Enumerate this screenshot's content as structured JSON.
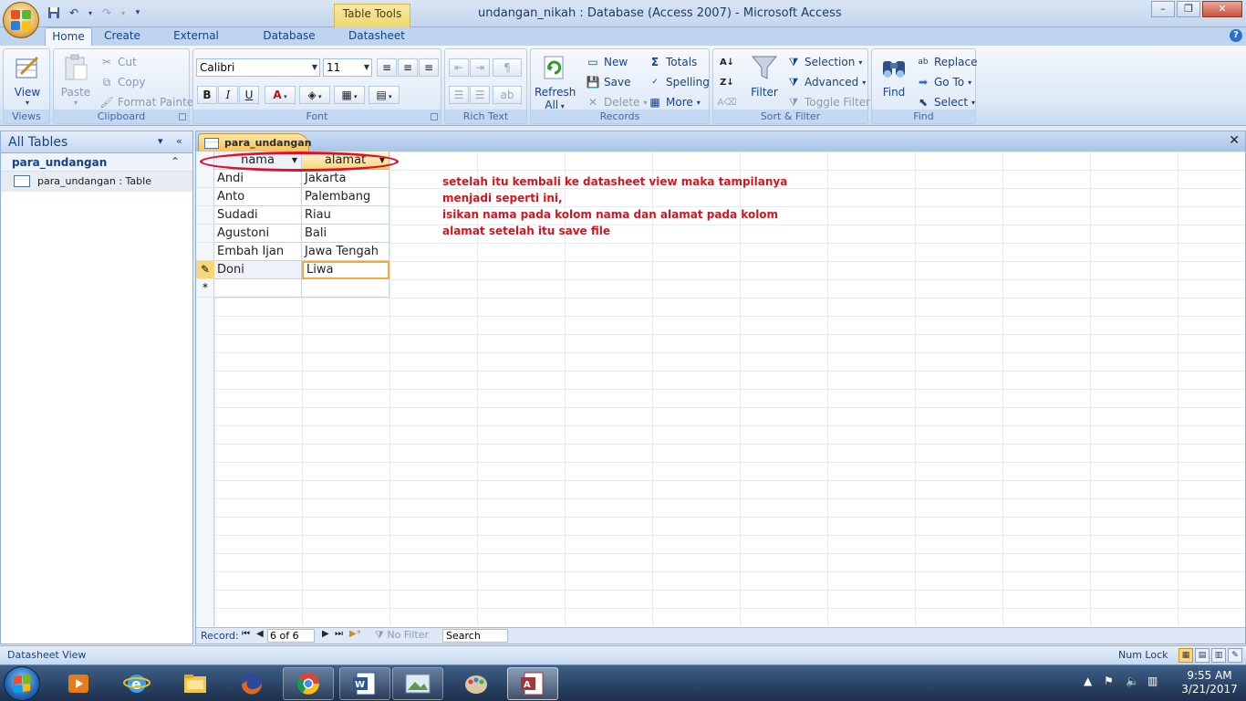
{
  "window": {
    "title": "undangan_nikah : Database (Access 2007) - Microsoft Access",
    "contextual_tab": "Table Tools"
  },
  "tabs": [
    "Home",
    "Create",
    "External Data",
    "Database Tools",
    "Datasheet"
  ],
  "ribbon": {
    "views": {
      "view": "View",
      "group": "Views"
    },
    "clipboard": {
      "paste": "Paste",
      "cut": "Cut",
      "copy": "Copy",
      "format_painter": "Format Painter",
      "group": "Clipboard"
    },
    "font": {
      "name": "Calibri",
      "size": "11",
      "bold": "B",
      "italic": "I",
      "underline": "U",
      "font_color": "A",
      "group": "Font"
    },
    "rich_text": {
      "group": "Rich Text"
    },
    "records": {
      "refresh": "Refresh",
      "refresh2": "All",
      "new": "New",
      "save": "Save",
      "delete": "Delete",
      "totals": "Totals",
      "spelling": "Spelling",
      "more": "More",
      "group": "Records"
    },
    "sort_filter": {
      "filter": "Filter",
      "selection": "Selection",
      "advanced": "Advanced",
      "toggle_filter": "Toggle Filter",
      "group": "Sort & Filter"
    },
    "find": {
      "find": "Find",
      "replace": "Replace",
      "goto": "Go To",
      "select": "Select",
      "group": "Find"
    }
  },
  "nav": {
    "header": "All Tables",
    "group": "para_undangan",
    "item": "para_undangan : Table"
  },
  "document": {
    "tab": "para_undangan",
    "columns": [
      "nama",
      "alamat"
    ],
    "rows": [
      {
        "nama": "Andi",
        "alamat": "Jakarta"
      },
      {
        "nama": "Anto",
        "alamat": "Palembang"
      },
      {
        "nama": "Sudadi",
        "alamat": "Riau"
      },
      {
        "nama": "Agustoni",
        "alamat": "Bali"
      },
      {
        "nama": "Embah Ijan",
        "alamat": "Jawa Tengah"
      },
      {
        "nama": "Doni",
        "alamat": "Liwa"
      }
    ],
    "new_row_marker": "*",
    "annotation": [
      "setelah itu kembali ke datasheet view maka tampilanya",
      "menjadi seperti ini,",
      "isikan nama pada kolom nama dan alamat pada kolom",
      "alamat setelah itu save file"
    ]
  },
  "record_nav": {
    "label": "Record:",
    "position": "6 of 6",
    "no_filter": "No Filter",
    "search": "Search"
  },
  "status": {
    "left": "Datasheet View",
    "num_lock": "Num Lock"
  },
  "taskbar": {
    "time": "9:55 AM",
    "date": "3/21/2017"
  },
  "colors": {
    "accent": "#15428b",
    "annotation": "#d7141e",
    "ellipse": "#e0102a",
    "header_fill": "#f9d67a"
  }
}
